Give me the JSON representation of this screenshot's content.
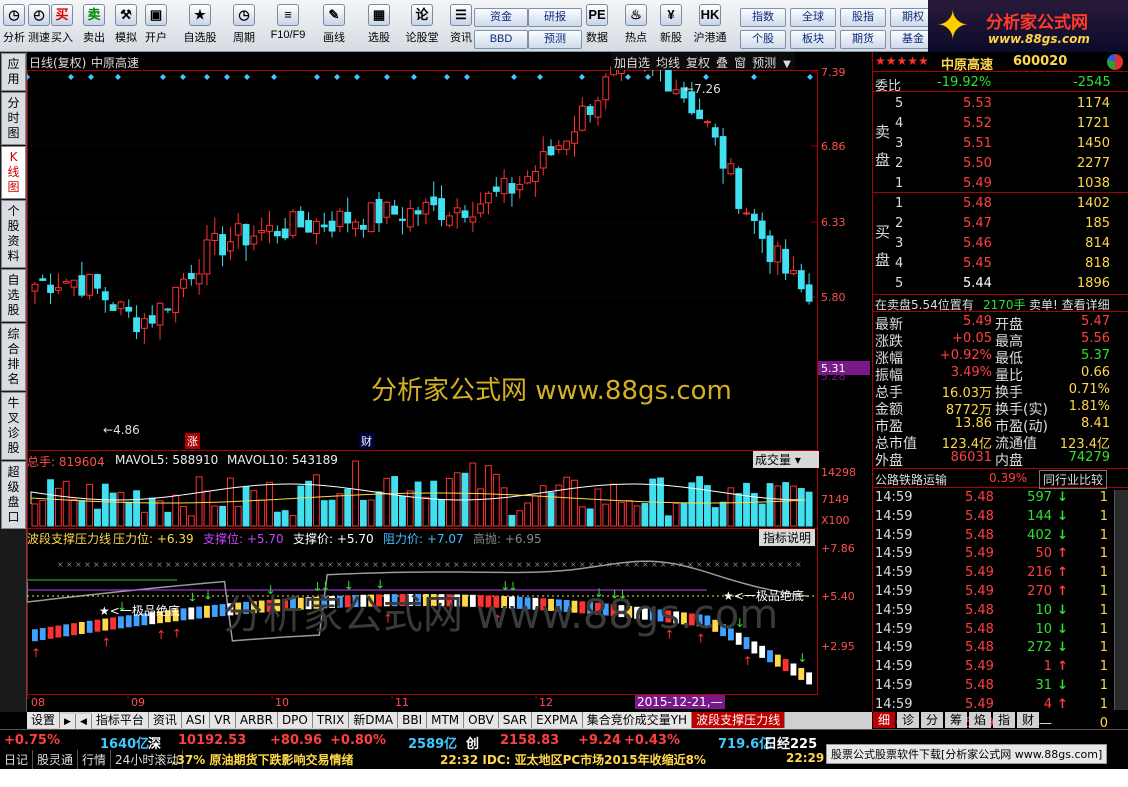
{
  "toolbar": {
    "buttons": [
      {
        "label": "分析",
        "icon": "clock-icon"
      },
      {
        "label": "测速",
        "icon": "speedometer-icon"
      },
      {
        "label": "买入",
        "icon": "buy-icon"
      },
      {
        "label": "卖出",
        "icon": "sell-icon"
      },
      {
        "label": "模拟",
        "icon": "hammer-icon"
      },
      {
        "label": "开户",
        "icon": "lock-icon"
      },
      {
        "label": "自选股",
        "icon": "star-icon"
      },
      {
        "label": "周期",
        "icon": "clock-icon"
      },
      {
        "label": "F10/F9",
        "icon": "document-icon"
      },
      {
        "label": "画线",
        "icon": "pencil-icon"
      },
      {
        "label": "选股",
        "icon": "chart-icon"
      },
      {
        "label": "论股堂",
        "icon": "chat-icon"
      },
      {
        "label": "资讯",
        "icon": "news-icon"
      },
      {
        "label": "数据",
        "icon": "pe-icon"
      },
      {
        "label": "热点",
        "icon": "fire-icon"
      },
      {
        "label": "新股",
        "icon": "piggy-icon"
      },
      {
        "label": "沪港通",
        "icon": "sse-hk-icon"
      }
    ],
    "mid_buttons": [
      "资金",
      "研报",
      "BBD",
      "预测"
    ],
    "right_buttons": [
      "指数",
      "全球",
      "股指",
      "期权",
      "个股",
      "板块",
      "期货",
      "基金"
    ],
    "logo_text": "分析家公式网",
    "logo_url": "www.88gs.com"
  },
  "left_tabs": [
    "应用",
    "分时图",
    "K线图",
    "个股资料",
    "自选股",
    "综合排名",
    "牛叉诊股",
    "超级盘口"
  ],
  "chart": {
    "header_left": "日线(复权)",
    "stock_name": "中原高速",
    "header_buttons": [
      "加自选",
      "均线",
      "复权",
      "叠",
      "窗",
      "预测"
    ],
    "price_axis": [
      "7.39",
      "6.86",
      "6.33",
      "5.80",
      "5.31",
      "5.28"
    ],
    "high_label": "7.26",
    "low_label": "4.86",
    "marks": [
      "涨",
      "财"
    ],
    "watermark": "分析家公式网  www.88gs.com",
    "volume": {
      "total": "总手: 819604",
      "mavol5": "MAVOL5: 588910",
      "mavol10": "MAVOL10: 543189",
      "selector": "成交量",
      "axis": [
        "14298",
        "7149",
        "X100"
      ]
    },
    "indicator": {
      "name": "波段支撑压力线",
      "pressure": "压力位: +6.39",
      "support": "支撑位: +5.70",
      "support_price": "支撑价: +5.70",
      "resist_price": "阻力价: +7.07",
      "high_throw": "高抛: +6.95",
      "explain": "指标说明",
      "axis": [
        "+7.86",
        "+5.40",
        "+2.95"
      ],
      "bottom_label_1": "★<一极品绝底",
      "bottom_label_2": "★<一极品绝底",
      "watermark": "分析家公式网 www.88gs.com"
    },
    "date_axis": [
      "08",
      "09",
      "10",
      "11",
      "12",
      "2015-12-21,—"
    ]
  },
  "right_panel": {
    "stars": "★★★★★",
    "stock_name": "中原高速",
    "stock_code": "600020",
    "weibi_label": "委比",
    "weibi": "-19.92%",
    "weicha": "-2545",
    "sell_label": "卖盘",
    "buy_label": "买盘",
    "sell": [
      {
        "n": "5",
        "p": "5.53",
        "v": "1174"
      },
      {
        "n": "4",
        "p": "5.52",
        "v": "1721"
      },
      {
        "n": "3",
        "p": "5.51",
        "v": "1450"
      },
      {
        "n": "2",
        "p": "5.50",
        "v": "2277"
      },
      {
        "n": "1",
        "p": "5.49",
        "v": "1038"
      }
    ],
    "buy": [
      {
        "n": "1",
        "p": "5.48",
        "v": "1402"
      },
      {
        "n": "2",
        "p": "5.47",
        "v": "185"
      },
      {
        "n": "3",
        "p": "5.46",
        "v": "814"
      },
      {
        "n": "4",
        "p": "5.45",
        "v": "818"
      },
      {
        "n": "5",
        "p": "5.44",
        "v": "1896"
      }
    ],
    "notice": "在卖盘5.54位置有",
    "notice_qty": "2170手",
    "notice_tail": "卖单! 查看详细",
    "stats": [
      {
        "l": "最新",
        "v": "5.49",
        "l2": "开盘",
        "v2": "5.47"
      },
      {
        "l": "涨跌",
        "v": "+0.05",
        "l2": "最高",
        "v2": "5.56"
      },
      {
        "l": "涨幅",
        "v": "+0.92%",
        "l2": "最低",
        "v2": "5.37"
      },
      {
        "l": "振幅",
        "v": "3.49%",
        "l2": "量比",
        "v2": "0.66"
      },
      {
        "l": "总手",
        "v": "16.03万",
        "l2": "换手",
        "v2": "0.71%"
      },
      {
        "l": "金额",
        "v": "8772万",
        "l2": "换手(实)",
        "v2": "1.81%"
      },
      {
        "l": "市盈",
        "v": "13.86",
        "l2": "市盈(动)",
        "v2": "8.41"
      },
      {
        "l": "总市值",
        "v": "123.4亿",
        "l2": "流通值",
        "v2": "123.4亿"
      },
      {
        "l": "外盘",
        "v": "86031",
        "l2": "内盘",
        "v2": "74279"
      }
    ],
    "sector": "公路铁路运输",
    "sector_pct": "0.39%",
    "sector_btn": "同行业比较",
    "ticks": [
      {
        "t": "14:59",
        "p": "5.48",
        "v": "597",
        "d": "down",
        "n": "1"
      },
      {
        "t": "14:59",
        "p": "5.48",
        "v": "144",
        "d": "down",
        "n": "1"
      },
      {
        "t": "14:59",
        "p": "5.48",
        "v": "402",
        "d": "down",
        "n": "1"
      },
      {
        "t": "14:59",
        "p": "5.49",
        "v": "50",
        "d": "up",
        "n": "1"
      },
      {
        "t": "14:59",
        "p": "5.49",
        "v": "216",
        "d": "up",
        "n": "1"
      },
      {
        "t": "14:59",
        "p": "5.49",
        "v": "270",
        "d": "up",
        "n": "1"
      },
      {
        "t": "14:59",
        "p": "5.48",
        "v": "10",
        "d": "down",
        "n": "1"
      },
      {
        "t": "14:59",
        "p": "5.48",
        "v": "10",
        "d": "down",
        "n": "1"
      },
      {
        "t": "14:59",
        "p": "5.48",
        "v": "272",
        "d": "down",
        "n": "1"
      },
      {
        "t": "14:59",
        "p": "5.49",
        "v": "1",
        "d": "up",
        "n": "1"
      },
      {
        "t": "14:59",
        "p": "5.48",
        "v": "31",
        "d": "down",
        "n": "1"
      },
      {
        "t": "14:59",
        "p": "5.49",
        "v": "4",
        "d": "up",
        "n": "1"
      },
      {
        "t": "15:00",
        "p": "5.49",
        "v": "—",
        "d": "",
        "n": "0"
      }
    ],
    "bottom_tabs": [
      "细",
      "诊",
      "分",
      "筹",
      "焰",
      "指",
      "财"
    ]
  },
  "bottom_tabs": [
    "设置",
    "指标平台",
    "资讯",
    "ASI",
    "VR",
    "ARBR",
    "DPO",
    "TRIX",
    "新DMA",
    "BBI",
    "MTM",
    "OBV",
    "SAR",
    "EXPMA",
    "集合竞价成交量YH",
    "波段支撑压力线"
  ],
  "status": {
    "row1": [
      {
        "t": "+0.75%",
        "c": "#ff4040"
      },
      {
        "t": "1640亿",
        "c": "#40c8ff"
      },
      {
        "t": "深",
        "c": "#fff"
      },
      {
        "t": "10192.53",
        "c": "#ff4040"
      },
      {
        "t": "+80.96",
        "c": "#ff4040"
      },
      {
        "t": "+0.80%",
        "c": "#ff4040"
      },
      {
        "t": "2589亿",
        "c": "#40c8ff"
      },
      {
        "t": "创",
        "c": "#fff"
      },
      {
        "t": "2158.83",
        "c": "#ff4040"
      },
      {
        "t": "+9.24",
        "c": "#ff4040"
      },
      {
        "t": "+0.43%",
        "c": "#ff4040"
      },
      {
        "t": "719.6亿",
        "c": "#40c8ff"
      },
      {
        "t": "日经225",
        "c": "#fff"
      }
    ],
    "row2_left": [
      "日记",
      "股灵通",
      "行情",
      "24小时滚动"
    ],
    "news1": ".37% 原油期货下跌影响交易情绪",
    "news2": "22:32 IDC: 亚太地区PC市场2015年收缩近8%",
    "clock": "22:29",
    "banner": "股票公式股票软件下载[分析家公式网 www.88gs.com]"
  }
}
